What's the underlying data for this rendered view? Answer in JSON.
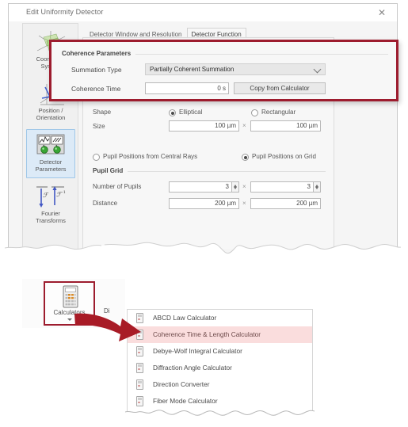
{
  "dialog": {
    "title": "Edit Uniformity Detector",
    "close_label": "✕",
    "tabs": [
      {
        "label": "Detector Window and Resolution",
        "active": false
      },
      {
        "label": "Detector Function",
        "active": true
      }
    ],
    "sidebar": [
      {
        "label": "Coordinate\nSystem",
        "icon": "coordinate-system-icon",
        "selected": false
      },
      {
        "label": "Position /\nOrientation",
        "icon": "position-orientation-icon",
        "selected": false
      },
      {
        "label": "Detector\nParameters",
        "icon": "detector-parameters-icon",
        "selected": true
      },
      {
        "label": "Fourier\nTransforms",
        "icon": "fourier-transforms-icon",
        "selected": false
      }
    ],
    "shape_group": {
      "shape_label": "Shape",
      "elliptical_label": "Elliptical",
      "elliptical_selected": true,
      "rectangular_label": "Rectangular",
      "rectangular_selected": false,
      "size_label": "Size",
      "size_x": "100 µm",
      "size_y": "100 µm",
      "times": "×"
    },
    "pupil_group": {
      "from_central_rays_label": "Pupil Positions from Central Rays",
      "from_central_rays_selected": false,
      "on_grid_label": "Pupil Positions on Grid",
      "on_grid_selected": true,
      "grid_title": "Pupil Grid",
      "number_label": "Number of Pupils",
      "number_x": "3",
      "number_y": "3",
      "distance_label": "Distance",
      "distance_x": "200 µm",
      "distance_y": "200 µm",
      "times": "×"
    }
  },
  "callout": {
    "title": "Coherence Parameters",
    "summation_label": "Summation Type",
    "summation_value": "Partially Coherent Summation",
    "coherence_time_label": "Coherence Time",
    "coherence_time_value": "0 s",
    "copy_button_label": "Copy from Calculator",
    "border_color": "#9d1c2e"
  },
  "ribbon": {
    "calculators_label": "Calculators",
    "calculators_icon": "calculator-icon",
    "dropdown_icon": "chevron-down-icon",
    "neighbor_label": "Di",
    "highlight_color": "#9d1c2e"
  },
  "menu": {
    "items": [
      {
        "label": "ABCD Law Calculator",
        "highlighted": false
      },
      {
        "label": "Coherence Time & Length Calculator",
        "highlighted": true
      },
      {
        "label": "Debye-Wolf Integral Calculator",
        "highlighted": false
      },
      {
        "label": "Diffraction Angle Calculator",
        "highlighted": false
      },
      {
        "label": "Direction Converter",
        "highlighted": false
      },
      {
        "label": "Fiber Mode Calculator",
        "highlighted": false
      }
    ],
    "highlight_color": "#fadddd"
  },
  "annotation": {
    "arrow_name": "pointer-arrow",
    "arrow_color": "#a81b26"
  }
}
